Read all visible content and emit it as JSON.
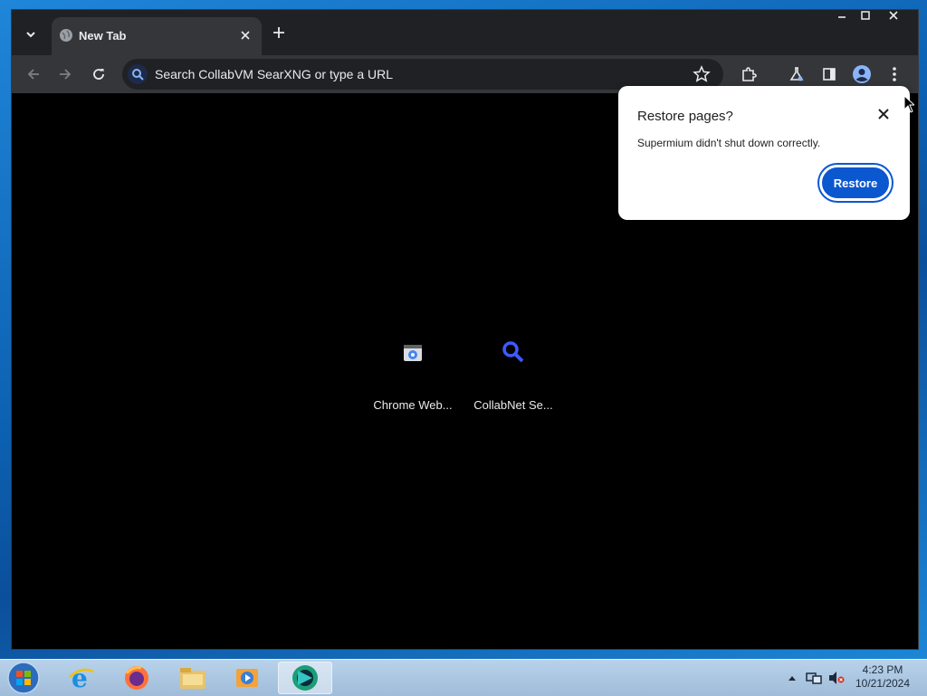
{
  "browser": {
    "tab_title": "New Tab",
    "omnibox_placeholder": "Search CollabVM SearXNG or type a URL"
  },
  "shortcuts": [
    {
      "label": "Chrome Web...",
      "icon": "chrome-web-store-icon"
    },
    {
      "label": "CollabNet Se...",
      "icon": "search-icon"
    }
  ],
  "popup": {
    "title": "Restore pages?",
    "message": "Supermium didn't shut down correctly.",
    "restore_label": "Restore"
  },
  "taskbar": {
    "apps": [
      "internet-explorer-icon",
      "firefox-icon",
      "file-explorer-icon",
      "media-player-icon",
      "supermium-icon"
    ],
    "time": "4:23 PM",
    "date": "10/21/2024"
  },
  "colors": {
    "accent": "#0b57d0",
    "frame": "#202124",
    "toolbar": "#35363a"
  }
}
